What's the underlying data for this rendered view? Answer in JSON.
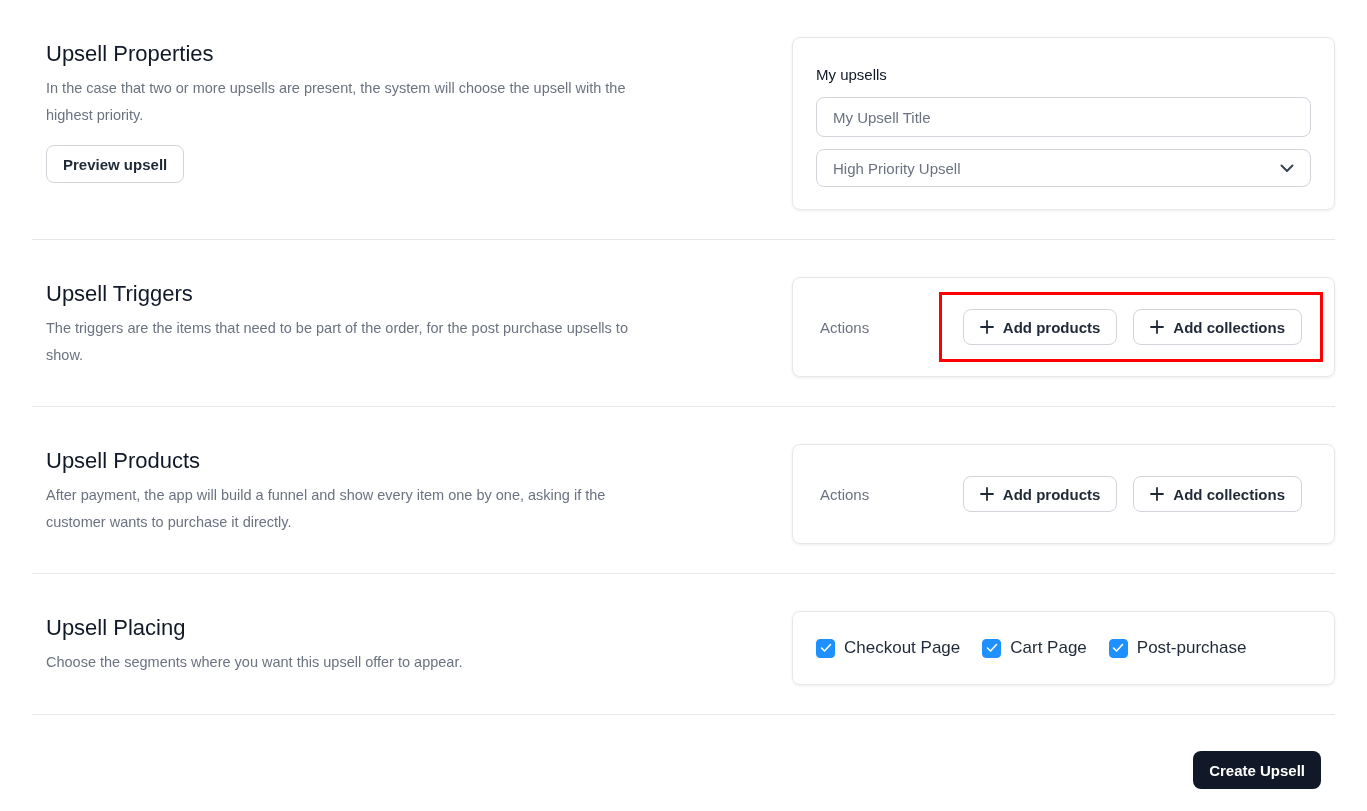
{
  "sections": [
    {
      "kind": "fields",
      "title": "Upsell Properties",
      "description": "In the case that two or more upsells are present, the system will choose the upsell with the highest priority.",
      "button": "Preview upsell",
      "card": {
        "label": "My upsells",
        "input": {
          "placeholder": "My Upsell Title"
        },
        "select": {
          "value": "High Priority Upsell"
        }
      }
    },
    {
      "kind": "actions",
      "title": "Upsell Triggers",
      "description": "The triggers are the items that need to be part of the order, for the post purchase upsells to show.",
      "card": {
        "label": "Actions",
        "highlighted": true,
        "buttons": [
          "Add products",
          "Add collections"
        ]
      }
    },
    {
      "kind": "actions",
      "title": "Upsell Products",
      "description": "After payment, the app will build a funnel and show every item one by one, asking if the customer wants to purchase it directly.",
      "card": {
        "label": "Actions",
        "highlighted": false,
        "buttons": [
          "Add products",
          "Add collections"
        ]
      }
    },
    {
      "kind": "checkboxes",
      "title": "Upsell Placing",
      "description": "Choose the segments where you want this upsell offer to appear.",
      "card": {
        "options": [
          {
            "label": "Checkout Page",
            "checked": true
          },
          {
            "label": "Cart Page",
            "checked": true
          },
          {
            "label": "Post-purchase",
            "checked": true
          }
        ]
      }
    }
  ],
  "submit_button": "Create Upsell"
}
